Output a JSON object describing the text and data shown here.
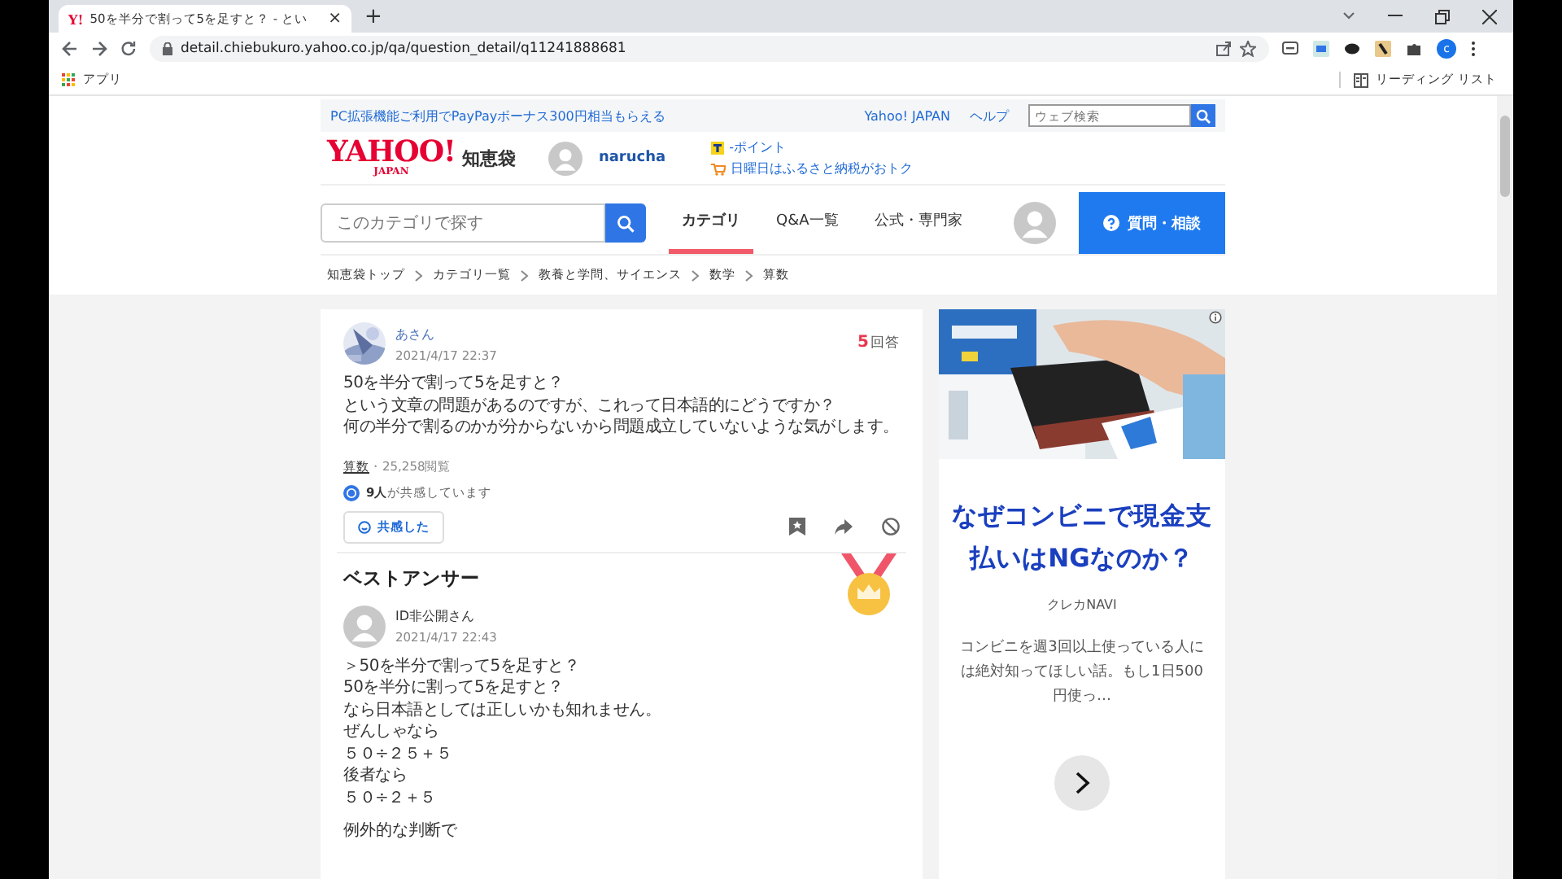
{
  "browser": {
    "tab": {
      "favicon": "Y!",
      "title": "50を半分で割って5を足すと？ - とい",
      "close": "×"
    },
    "new_tab": "+",
    "url": "detail.chiebukuro.yahoo.co.jp/qa/question_detail/q11241888681",
    "profile": "c",
    "bookmarks": [
      {
        "label": "アプリ"
      }
    ],
    "reading_list": "リーディング リスト"
  },
  "top_bar": {
    "promo": "PC拡張機能ご利用でPayPayボーナス300円相当もらえる",
    "links": [
      "Yahoo! JAPAN",
      "ヘルプ"
    ],
    "search_placeholder": "ウェブ検索"
  },
  "header": {
    "logo": "YAHOO!",
    "logo_sub": "JAPAN",
    "service": "知恵袋",
    "user": "narucha",
    "points": "-ポイント",
    "campaign": "日曜日はふるさと納税がおトク"
  },
  "nav": {
    "search_placeholder": "このカテゴリで探す",
    "tabs": [
      {
        "label": "カテゴリ",
        "selected": true
      },
      {
        "label": "Q&A一覧",
        "selected": false
      },
      {
        "label": "公式・専門家",
        "selected": false
      }
    ],
    "ask_button": "質問・相談"
  },
  "breadcrumb": [
    "知恵袋トップ",
    "カテゴリ一覧",
    "教養と学問、サイエンス",
    "数学",
    "算数"
  ],
  "question": {
    "user": "あさん",
    "date": "2021/4/17 22:37",
    "answer_count": "5",
    "answer_label": "回答",
    "lines": [
      "50を半分で割って5を足すと？",
      "という文章の問題があるのですが、これって日本語的にどうですか？",
      "何の半分で割るのかが分からないから問題成立していないような気がします。"
    ],
    "category": "算数",
    "views": "・25,258閲覧",
    "empathy": "**9人**が共感しています",
    "empathy_button": "共感した"
  },
  "best_answer": {
    "heading": "ベストアンサー",
    "user": "ID非公開さん",
    "date": "2021/4/17 22:43",
    "lines": [
      "＞50を半分で割って5を足すと？",
      "50を半分に割って5を足すと？",
      "なら日本語としては正しいかも知れません。",
      "ぜんしゃなら",
      "５０÷２５＋５",
      "後者なら",
      "５０÷２＋５"
    ],
    "more": "例外的な判断で"
  },
  "ad": {
    "kind": "picture",
    "headline": "なぜコンビニで現金支払いはNGなのか？",
    "source": "クレカNAVI",
    "description": "コンビニを週3回以上使っている人には絶対知ってほしい話。もし1日500円使っ…"
  }
}
